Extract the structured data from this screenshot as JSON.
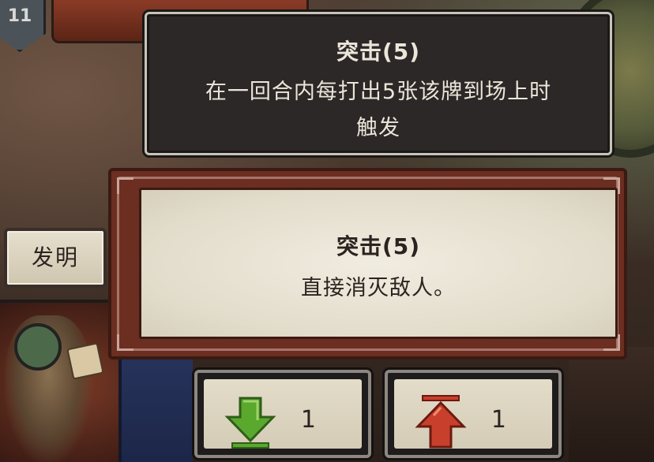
{
  "hud": {
    "level": "11"
  },
  "tooltip": {
    "title": "突击(5)",
    "description_line1": "在一回合内每打出5张该牌到场上时",
    "description_line2": "触发"
  },
  "card": {
    "title": "突击(5)",
    "description": "直接消灭敌人。"
  },
  "invent_button": {
    "label": "发明"
  },
  "downvote": {
    "icon": "green-down-arrow-icon",
    "count": "1",
    "color": "#5aa82e"
  },
  "upvote": {
    "icon": "red-up-arrow-icon",
    "count": "1",
    "color": "#c8402c"
  }
}
